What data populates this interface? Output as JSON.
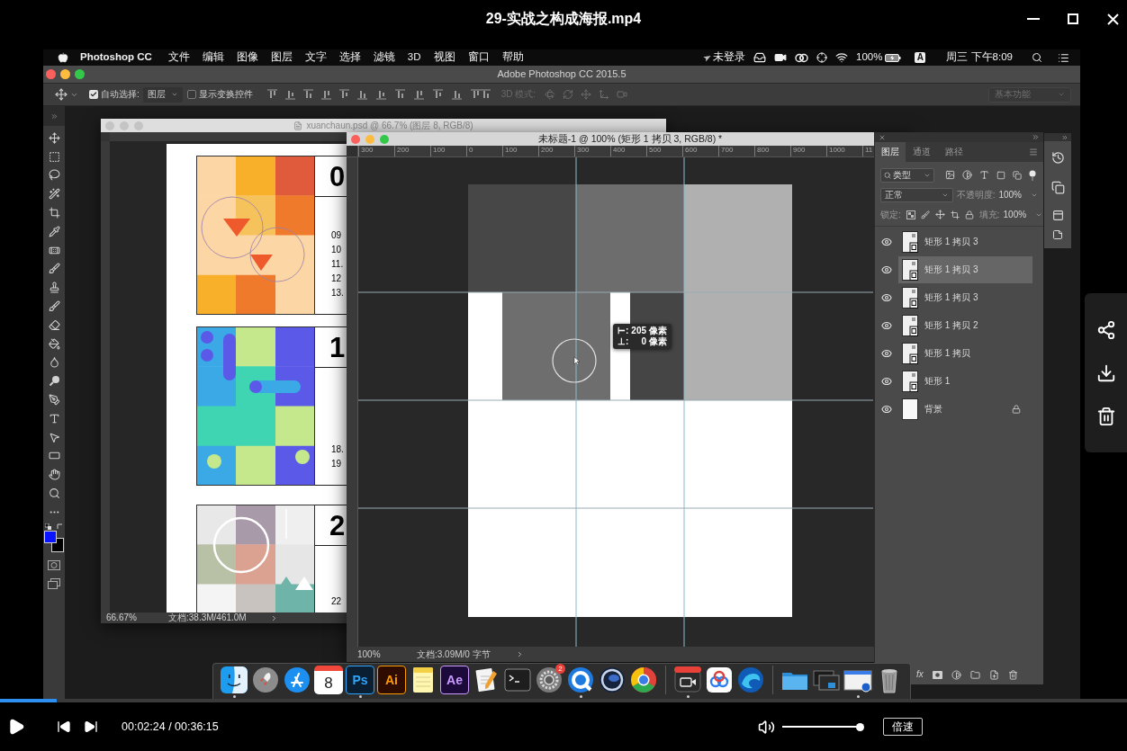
{
  "player": {
    "title": "29-实战之构成海报.mp4",
    "playing": false,
    "progress": {
      "level": 0.05
    },
    "time": "00:02:24 / 00:36:15",
    "volume": {
      "level": 1
    },
    "speed": "倍速"
  },
  "menu_bar": {
    "app": "Photoshop CC",
    "menus": [
      "文件",
      "编辑",
      "图像",
      "图层",
      "文字",
      "选择",
      "滤镜",
      "3D",
      "视图",
      "窗口",
      "帮助"
    ],
    "login": "未登录",
    "battery": "100%",
    "input_source": "A",
    "clock": "周三 下午8:09"
  },
  "photoshop": {
    "title": "Adobe Photoshop CC 2015.5",
    "options_bar": {
      "auto_select": {
        "label": "自动选择:",
        "checked": true
      },
      "auto_select_target": "图层",
      "transform_controls": {
        "label": "显示变换控件",
        "checked": false
      },
      "mode_3d": {
        "label": "3D 模式:",
        "disabled": true
      },
      "workspace": "基本功能"
    },
    "back_document": {
      "title": "xuanchaun.psd @ 66.7% (图层 8, RGB/8)",
      "active": false,
      "sections": [
        {
          "kind": "orange",
          "number": "0",
          "dates": [
            "09",
            "10",
            "11.",
            "12",
            "13."
          ]
        },
        {
          "kind": "blue",
          "number": "1",
          "dates": [
            "18.",
            "19"
          ]
        },
        {
          "kind": "pastel",
          "number": "2",
          "dates": [
            "22"
          ]
        }
      ],
      "zoom": "66.67%",
      "doc_size": "文档:38.3M/461.0M"
    },
    "front_document": {
      "title": "未标题-1 @ 100% (矩形 1 拷贝 3, RGB/8) *",
      "active": true,
      "ruler": [
        "300",
        "200",
        "100",
        "0",
        "100",
        "200",
        "300",
        "400",
        "500",
        "600",
        "700",
        "800",
        "900",
        "1000",
        "11"
      ],
      "measure": [
        {
          "label": "⊢:",
          "value": "205 像素"
        },
        {
          "label": "⊥:",
          "value": "0 像素"
        }
      ],
      "zoom": "100%",
      "doc_size": "文档:3.09M/0 字节"
    },
    "layers_panel": {
      "tabs": [
        {
          "label": "图层",
          "selected": true
        },
        {
          "label": "通道",
          "selected": false
        },
        {
          "label": "路径",
          "selected": false
        }
      ],
      "filter": "类型",
      "blend_mode": "正常",
      "opacity_label": "不透明度:",
      "opacity": "100%",
      "lock_label": "锁定:",
      "fill_label": "填充:",
      "fill": "100%",
      "layers": [
        {
          "name": "矩形 1 拷贝 3",
          "kind": "shape",
          "visible": true,
          "selected": false,
          "locked": false
        },
        {
          "name": "矩形 1 拷贝 3",
          "kind": "shape",
          "visible": true,
          "selected": true,
          "locked": false
        },
        {
          "name": "矩形 1 拷贝 3",
          "kind": "shape",
          "visible": true,
          "selected": false,
          "locked": false
        },
        {
          "name": "矩形 1 拷贝 2",
          "kind": "shape",
          "visible": true,
          "selected": false,
          "locked": false
        },
        {
          "name": "矩形 1 拷贝",
          "kind": "shape",
          "visible": true,
          "selected": false,
          "locked": false
        },
        {
          "name": "矩形 1",
          "kind": "shape",
          "visible": true,
          "selected": false,
          "locked": false
        },
        {
          "name": "背景",
          "kind": "background",
          "visible": true,
          "selected": false,
          "locked": true
        }
      ],
      "footer_fx": "fx"
    }
  },
  "dock": [
    {
      "kind": "finder",
      "running": true
    },
    {
      "kind": "launchpad",
      "running": false
    },
    {
      "kind": "store",
      "running": false
    },
    {
      "kind": "calendar",
      "label": "8",
      "running": false
    },
    {
      "kind": "ps",
      "label": "Ps",
      "running": true
    },
    {
      "kind": "ai",
      "label": "Ai",
      "running": false
    },
    {
      "kind": "notes",
      "running": false
    },
    {
      "kind": "ae",
      "label": "Ae",
      "running": false
    },
    {
      "kind": "script",
      "running": false
    },
    {
      "kind": "terminal",
      "running": false
    },
    {
      "kind": "settings",
      "badge": "2",
      "running": false
    },
    {
      "kind": "ring",
      "running": true
    },
    {
      "kind": "sphere",
      "running": false
    },
    {
      "kind": "wheel",
      "running": false
    },
    {
      "kind": "separator"
    },
    {
      "kind": "recorder",
      "running": true
    },
    {
      "kind": "cloud",
      "running": false
    },
    {
      "kind": "wave",
      "running": false
    },
    {
      "kind": "separator"
    },
    {
      "kind": "folder",
      "running": false
    },
    {
      "kind": "windows",
      "running": false
    },
    {
      "kind": "preview",
      "running": true
    },
    {
      "kind": "trash",
      "running": false
    }
  ]
}
